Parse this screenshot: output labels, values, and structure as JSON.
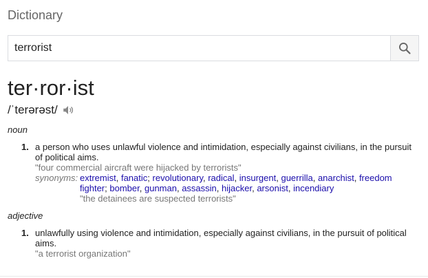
{
  "header": {
    "title": "Dictionary"
  },
  "search": {
    "value": "terrorist",
    "icon": "search-icon"
  },
  "entry": {
    "word": "ter·ror·ist",
    "phonetic": "/ˈterərəst/",
    "audio_icon": "speaker-icon"
  },
  "noun": {
    "pos": "noun",
    "number": "1.",
    "definition": "a person who uses unlawful violence and intimidation, especially against civilians, in the pursuit of political aims.",
    "example1": "\"four commercial aircraft were hijacked by terrorists\"",
    "synonyms_label": "synonyms:",
    "synonyms": [
      "extremist",
      "fanatic",
      "revolutionary",
      "radical",
      "insurgent",
      "guerrilla",
      "anarchist",
      "freedom fighter",
      "bomber",
      "gunman",
      "assassin",
      "hijacker",
      "arsonist",
      "incendiary"
    ],
    "synonym_separators": [
      ", ",
      "; ",
      ", ",
      ", ",
      ", ",
      ", ",
      ", ",
      "; ",
      ", ",
      ", ",
      ", ",
      ", ",
      ", ",
      ""
    ],
    "example2": "\"the detainees are suspected terrorists\""
  },
  "adjective": {
    "pos": "adjective",
    "number": "1.",
    "definition": "unlawfully using violence and intimidation, especially against civilians, in the pursuit of political aims.",
    "example": "\"a terrorist organization\""
  }
}
